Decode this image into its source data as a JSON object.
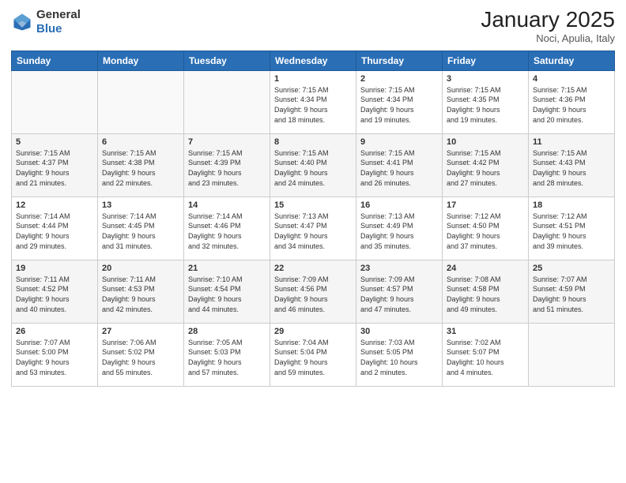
{
  "header": {
    "logo_general": "General",
    "logo_blue": "Blue",
    "month": "January 2025",
    "location": "Noci, Apulia, Italy"
  },
  "days_of_week": [
    "Sunday",
    "Monday",
    "Tuesday",
    "Wednesday",
    "Thursday",
    "Friday",
    "Saturday"
  ],
  "weeks": [
    [
      {
        "day": "",
        "content": ""
      },
      {
        "day": "",
        "content": ""
      },
      {
        "day": "",
        "content": ""
      },
      {
        "day": "1",
        "content": "Sunrise: 7:15 AM\nSunset: 4:34 PM\nDaylight: 9 hours\nand 18 minutes."
      },
      {
        "day": "2",
        "content": "Sunrise: 7:15 AM\nSunset: 4:34 PM\nDaylight: 9 hours\nand 19 minutes."
      },
      {
        "day": "3",
        "content": "Sunrise: 7:15 AM\nSunset: 4:35 PM\nDaylight: 9 hours\nand 19 minutes."
      },
      {
        "day": "4",
        "content": "Sunrise: 7:15 AM\nSunset: 4:36 PM\nDaylight: 9 hours\nand 20 minutes."
      }
    ],
    [
      {
        "day": "5",
        "content": "Sunrise: 7:15 AM\nSunset: 4:37 PM\nDaylight: 9 hours\nand 21 minutes."
      },
      {
        "day": "6",
        "content": "Sunrise: 7:15 AM\nSunset: 4:38 PM\nDaylight: 9 hours\nand 22 minutes."
      },
      {
        "day": "7",
        "content": "Sunrise: 7:15 AM\nSunset: 4:39 PM\nDaylight: 9 hours\nand 23 minutes."
      },
      {
        "day": "8",
        "content": "Sunrise: 7:15 AM\nSunset: 4:40 PM\nDaylight: 9 hours\nand 24 minutes."
      },
      {
        "day": "9",
        "content": "Sunrise: 7:15 AM\nSunset: 4:41 PM\nDaylight: 9 hours\nand 26 minutes."
      },
      {
        "day": "10",
        "content": "Sunrise: 7:15 AM\nSunset: 4:42 PM\nDaylight: 9 hours\nand 27 minutes."
      },
      {
        "day": "11",
        "content": "Sunrise: 7:15 AM\nSunset: 4:43 PM\nDaylight: 9 hours\nand 28 minutes."
      }
    ],
    [
      {
        "day": "12",
        "content": "Sunrise: 7:14 AM\nSunset: 4:44 PM\nDaylight: 9 hours\nand 29 minutes."
      },
      {
        "day": "13",
        "content": "Sunrise: 7:14 AM\nSunset: 4:45 PM\nDaylight: 9 hours\nand 31 minutes."
      },
      {
        "day": "14",
        "content": "Sunrise: 7:14 AM\nSunset: 4:46 PM\nDaylight: 9 hours\nand 32 minutes."
      },
      {
        "day": "15",
        "content": "Sunrise: 7:13 AM\nSunset: 4:47 PM\nDaylight: 9 hours\nand 34 minutes."
      },
      {
        "day": "16",
        "content": "Sunrise: 7:13 AM\nSunset: 4:49 PM\nDaylight: 9 hours\nand 35 minutes."
      },
      {
        "day": "17",
        "content": "Sunrise: 7:12 AM\nSunset: 4:50 PM\nDaylight: 9 hours\nand 37 minutes."
      },
      {
        "day": "18",
        "content": "Sunrise: 7:12 AM\nSunset: 4:51 PM\nDaylight: 9 hours\nand 39 minutes."
      }
    ],
    [
      {
        "day": "19",
        "content": "Sunrise: 7:11 AM\nSunset: 4:52 PM\nDaylight: 9 hours\nand 40 minutes."
      },
      {
        "day": "20",
        "content": "Sunrise: 7:11 AM\nSunset: 4:53 PM\nDaylight: 9 hours\nand 42 minutes."
      },
      {
        "day": "21",
        "content": "Sunrise: 7:10 AM\nSunset: 4:54 PM\nDaylight: 9 hours\nand 44 minutes."
      },
      {
        "day": "22",
        "content": "Sunrise: 7:09 AM\nSunset: 4:56 PM\nDaylight: 9 hours\nand 46 minutes."
      },
      {
        "day": "23",
        "content": "Sunrise: 7:09 AM\nSunset: 4:57 PM\nDaylight: 9 hours\nand 47 minutes."
      },
      {
        "day": "24",
        "content": "Sunrise: 7:08 AM\nSunset: 4:58 PM\nDaylight: 9 hours\nand 49 minutes."
      },
      {
        "day": "25",
        "content": "Sunrise: 7:07 AM\nSunset: 4:59 PM\nDaylight: 9 hours\nand 51 minutes."
      }
    ],
    [
      {
        "day": "26",
        "content": "Sunrise: 7:07 AM\nSunset: 5:00 PM\nDaylight: 9 hours\nand 53 minutes."
      },
      {
        "day": "27",
        "content": "Sunrise: 7:06 AM\nSunset: 5:02 PM\nDaylight: 9 hours\nand 55 minutes."
      },
      {
        "day": "28",
        "content": "Sunrise: 7:05 AM\nSunset: 5:03 PM\nDaylight: 9 hours\nand 57 minutes."
      },
      {
        "day": "29",
        "content": "Sunrise: 7:04 AM\nSunset: 5:04 PM\nDaylight: 9 hours\nand 59 minutes."
      },
      {
        "day": "30",
        "content": "Sunrise: 7:03 AM\nSunset: 5:05 PM\nDaylight: 10 hours\nand 2 minutes."
      },
      {
        "day": "31",
        "content": "Sunrise: 7:02 AM\nSunset: 5:07 PM\nDaylight: 10 hours\nand 4 minutes."
      },
      {
        "day": "",
        "content": ""
      }
    ]
  ]
}
